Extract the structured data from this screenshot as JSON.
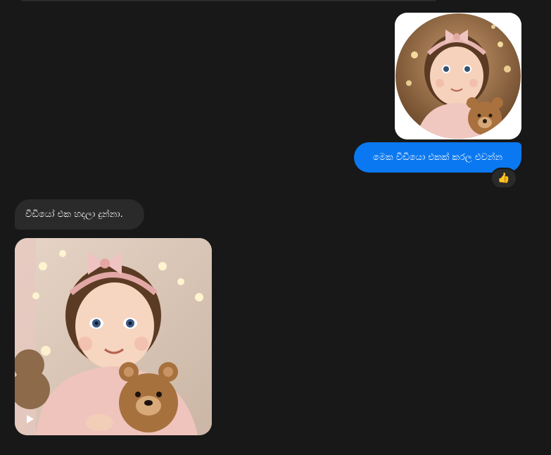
{
  "thread": {
    "sent_image": {
      "icon": "photo-baby-with-teddy-circular"
    },
    "sent_message": "මෙක විඩියො එකක් කරල එවන්න",
    "reaction": {
      "emoji": "👍",
      "icon": "thumbs-up-icon"
    },
    "received_message": "වීඩියෝ එක හදලා දුන්නා.",
    "received_video": {
      "icon": "video-baby-with-teddy",
      "play_icon": "play-icon"
    }
  },
  "colors": {
    "background": "#181818",
    "sent_bubble": "#0a78f0",
    "received_bubble": "#2a2a2a"
  }
}
